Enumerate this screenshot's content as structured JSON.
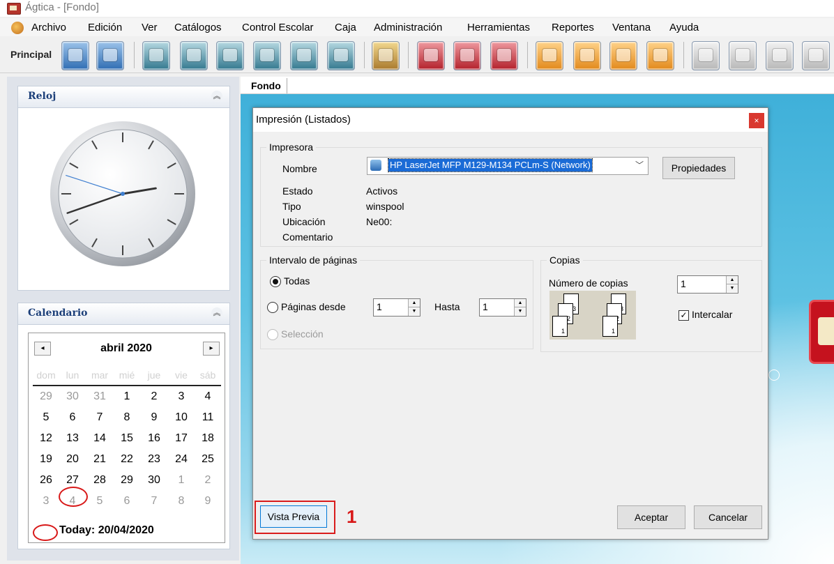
{
  "window": {
    "title": "Ágtica - [Fondo]"
  },
  "menu": [
    "Archivo",
    "Edición",
    "Ver",
    "Catálogos",
    "Control Escolar",
    "Caja",
    "Administración",
    "Herramientas",
    "Reportes",
    "Ventana",
    "Ayuda"
  ],
  "toolbar": {
    "label": "Principal"
  },
  "clock_panel": {
    "title": "Reloj",
    "time": {
      "hours": 2,
      "minutes": 41,
      "seconds": 48
    }
  },
  "calendar_panel": {
    "title": "Calendario",
    "month": "abril 2020",
    "prev": "◂",
    "next": "▸",
    "weekdays": [
      "dom",
      "lun",
      "mar",
      "mié",
      "jue",
      "vie",
      "sáb"
    ],
    "weeks": [
      [
        "29",
        "30",
        "31",
        "1",
        "2",
        "3",
        "4"
      ],
      [
        "5",
        "6",
        "7",
        "8",
        "9",
        "10",
        "11"
      ],
      [
        "12",
        "13",
        "14",
        "15",
        "16",
        "17",
        "18"
      ],
      [
        "19",
        "20",
        "21",
        "22",
        "23",
        "24",
        "25"
      ],
      [
        "26",
        "27",
        "28",
        "29",
        "30",
        "1",
        "2"
      ],
      [
        "3",
        "4",
        "5",
        "6",
        "7",
        "8",
        "9"
      ]
    ],
    "today_label": "Today: 20/04/2020"
  },
  "tab": {
    "label": "Fondo"
  },
  "dialog": {
    "title": "Impresión (Listados)",
    "close": "×",
    "printer_group": {
      "title": "Impresora",
      "name_label": "Nombre",
      "name_value": "HP LaserJet MFP M129-M134 PCLm-S (Network)",
      "properties_button": "Propiedades",
      "status_label": "Estado",
      "status_value": "Activos",
      "type_label": "Tipo",
      "type_value": "winspool",
      "location_label": "Ubicación",
      "location_value": "Ne00:",
      "comment_label": "Comentario"
    },
    "range_group": {
      "title": "Intervalo de páginas",
      "all_label": "Todas",
      "from_label": "Páginas desde",
      "from_value": "1",
      "to_label": "Hasta",
      "to_value": "1",
      "selection_label": "Selección"
    },
    "copies_group": {
      "title": "Copias",
      "count_label": "Número de copias",
      "count_value": "1",
      "collate_label": "Intercalar",
      "collate_checked": true
    },
    "preview_button": "Vista Previa",
    "accept_button": "Aceptar",
    "cancel_button": "Cancelar"
  },
  "annotation": {
    "step_number": "1"
  }
}
